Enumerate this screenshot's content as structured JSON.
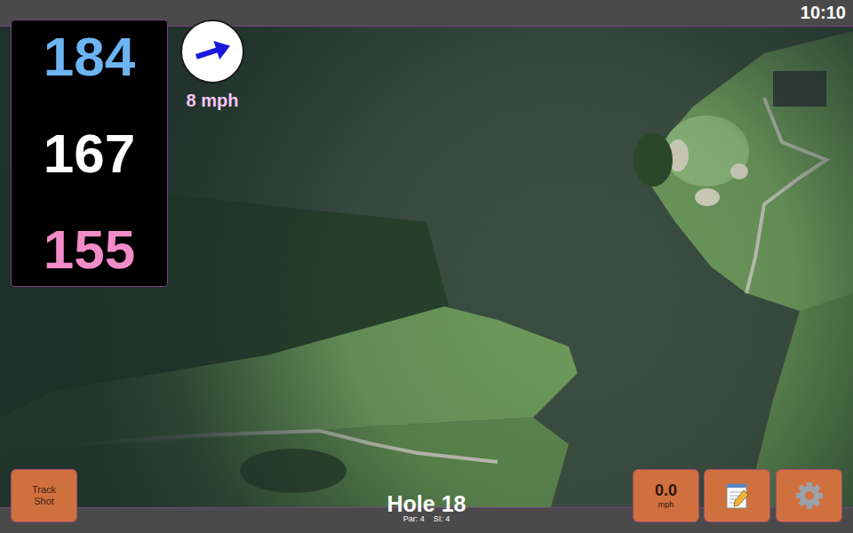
{
  "status_bar": {
    "time": "10:10"
  },
  "distances": [
    {
      "value": "184",
      "color": "#6cb4f2"
    },
    {
      "value": "167",
      "color": "#ffffff"
    },
    {
      "value": "155",
      "color": "#f28cc9"
    }
  ],
  "wind": {
    "speed": "8 mph"
  },
  "hole": {
    "title": "Hole 18",
    "par": "Par: 4",
    "si": "SI: 4"
  },
  "buttons": {
    "track_shot": "Track Shot",
    "speed": {
      "value": "0.0",
      "unit": "mph"
    }
  }
}
